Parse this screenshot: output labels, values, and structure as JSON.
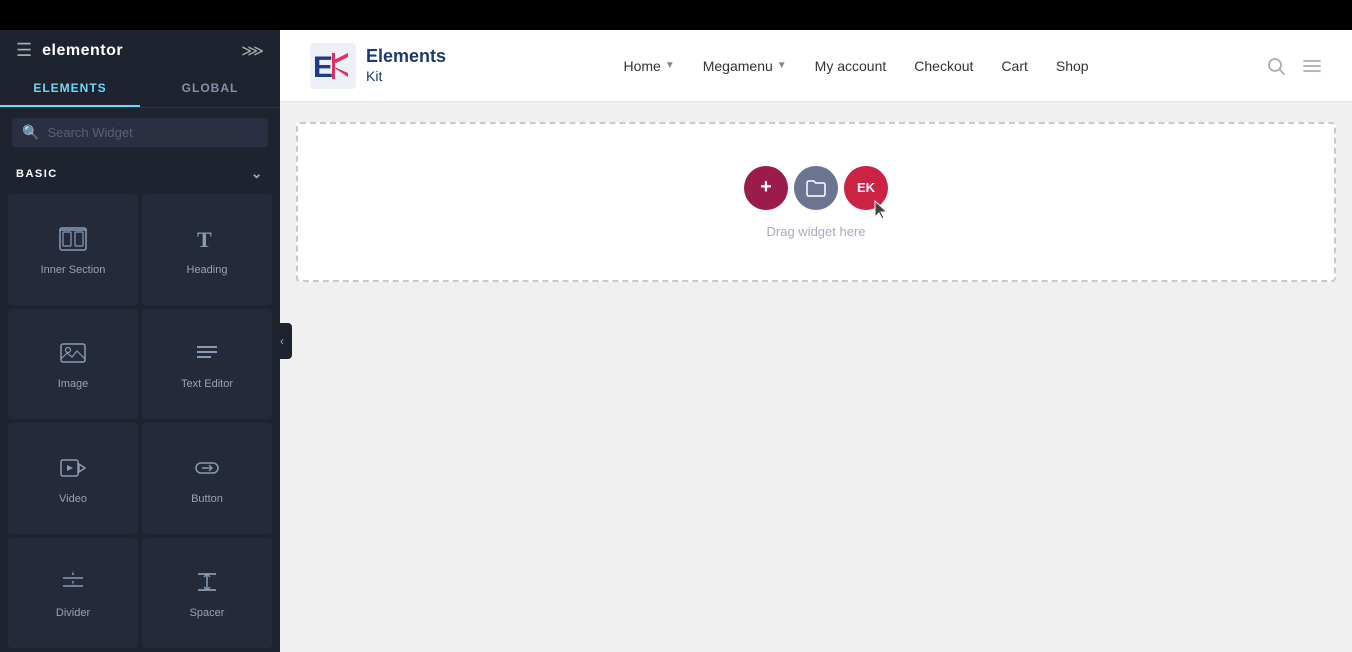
{
  "topbar": {
    "background": "#000000"
  },
  "sidebar": {
    "logo_text": "elementor",
    "tabs": [
      {
        "id": "elements",
        "label": "ELEMENTS",
        "active": true
      },
      {
        "id": "global",
        "label": "GLOBAL",
        "active": false
      }
    ],
    "search": {
      "placeholder": "Search Widget"
    },
    "category": {
      "label": "BASIC"
    },
    "widgets": [
      {
        "id": "inner-section",
        "label": "Inner Section",
        "icon": "inner-section-icon"
      },
      {
        "id": "heading",
        "label": "Heading",
        "icon": "heading-icon"
      },
      {
        "id": "image",
        "label": "Image",
        "icon": "image-icon"
      },
      {
        "id": "text-editor",
        "label": "Text Editor",
        "icon": "text-editor-icon"
      },
      {
        "id": "video",
        "label": "Video",
        "icon": "video-icon"
      },
      {
        "id": "button",
        "label": "Button",
        "icon": "button-icon"
      },
      {
        "id": "divider",
        "label": "Divider",
        "icon": "divider-icon"
      },
      {
        "id": "spacer",
        "label": "Spacer",
        "icon": "spacer-icon"
      }
    ],
    "collapse_arrow": "‹"
  },
  "canvas": {
    "nav": {
      "logo_brand_top": "Elements",
      "logo_brand_bottom": "Kit",
      "menu_items": [
        {
          "id": "home",
          "label": "Home",
          "has_dropdown": true
        },
        {
          "id": "megamenu",
          "label": "Megamenu",
          "has_dropdown": true
        },
        {
          "id": "my-account",
          "label": "My account",
          "has_dropdown": false
        },
        {
          "id": "checkout",
          "label": "Checkout",
          "has_dropdown": false
        },
        {
          "id": "cart",
          "label": "Cart",
          "has_dropdown": false
        },
        {
          "id": "shop",
          "label": "Shop",
          "has_dropdown": false
        }
      ]
    },
    "drop_zone": {
      "label": "Drag widget here",
      "add_btn_label": "+",
      "ek_btn_label": "EK"
    }
  }
}
